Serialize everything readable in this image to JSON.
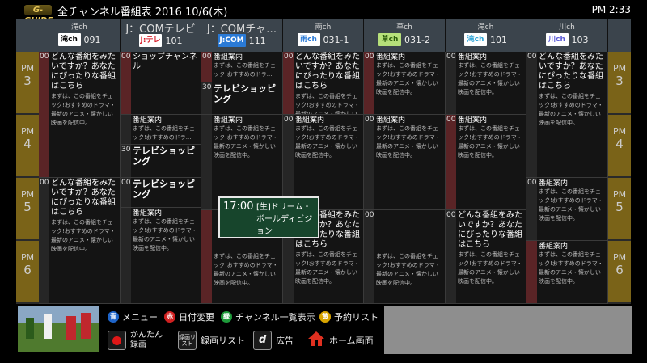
{
  "header": {
    "logo": "G-GUIDE",
    "title": "全チャンネル番組表 2016 10/6(木)",
    "clock": "PM 2:33"
  },
  "hours": [
    {
      "ampm": "PM",
      "hour": "3"
    },
    {
      "ampm": "PM",
      "hour": "4"
    },
    {
      "ampm": "PM",
      "hour": "5"
    },
    {
      "ampm": "PM",
      "hour": "6"
    }
  ],
  "channels": [
    {
      "name": "滝ch",
      "logo": "滝ch",
      "number": "091",
      "logo_color": "#000000"
    },
    {
      "name": "J：COMテレビ",
      "logo": "J:テレ",
      "number": "101",
      "logo_color": "#d61d2a"
    },
    {
      "name": "J：COMチャ…",
      "logo": "J:COM",
      "number": "111",
      "logo_color": "#2a7ad6"
    },
    {
      "name": "雨ch",
      "logo": "雨ch",
      "number": "031-1",
      "logo_color": "#2a7ad6"
    },
    {
      "name": "草ch",
      "logo": "草ch",
      "number": "031-2",
      "logo_color": "#4a9a1a"
    },
    {
      "name": "滝ch",
      "logo": "滝ch",
      "number": "101",
      "logo_color": "#2aa3d6"
    },
    {
      "name": "川ch",
      "logo": "川ch",
      "number": "103",
      "logo_color": "#5a5ad6"
    }
  ],
  "texts": {
    "q": "どんな番組をみたいですか？あなたにぴったりな番組はこちら",
    "q_desc": "まずは、この番組をチェック!おすすめのドラマ・最新のアニメ・懐かしい映画を配信中。",
    "annai": "番組案内",
    "annai_desc": "まずは、この番組をチェック!おすすめのドラマ・最新のアニメ・懐かしい映画を配信中。",
    "annai_desc_short": "まずは、この番組をチェック!おすすめのドラ...",
    "shop_channel": "ショップチャンネル",
    "tv_shopping": "テレビショッピング",
    "min00": "00",
    "min30": "30"
  },
  "popup": {
    "time": "17:00",
    "title": "[生]ドリーム・ボールディビジョン"
  },
  "buttons": {
    "blue": {
      "key": "青",
      "label": "メニュー",
      "color": "#1e64c8"
    },
    "red": {
      "key": "赤",
      "label": "日付変更",
      "color": "#d02020"
    },
    "green": {
      "key": "緑",
      "label": "チャンネル一覧表示",
      "color": "#1e9a3a"
    },
    "yellow": {
      "key": "黄",
      "label": "予約リスト",
      "color": "#d8a400"
    },
    "easy_rec": "かんたん録画",
    "rec_list_key": "録画リスト",
    "rec_list": "録画リスト",
    "ad_key": "d",
    "ad": "広告",
    "home": "ホーム画面"
  }
}
